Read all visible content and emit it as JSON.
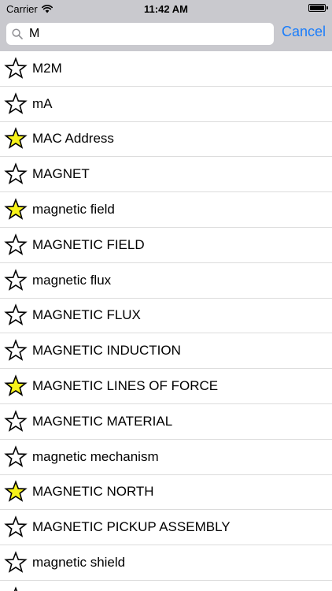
{
  "status_bar": {
    "carrier": "Carrier",
    "time": "11:42 AM"
  },
  "search": {
    "value": "M",
    "cancel_label": "Cancel"
  },
  "colors": {
    "accent": "#1a7dfb",
    "star_favorite": "#f7f21a",
    "star_outline": "#000000"
  },
  "terms": [
    {
      "label": "M2M",
      "favorite": false
    },
    {
      "label": "mA",
      "favorite": false
    },
    {
      "label": "MAC Address",
      "favorite": true
    },
    {
      "label": "MAGNET",
      "favorite": false
    },
    {
      "label": "magnetic field",
      "favorite": true
    },
    {
      "label": "MAGNETIC FIELD",
      "favorite": false
    },
    {
      "label": "magnetic flux",
      "favorite": false
    },
    {
      "label": "MAGNETIC FLUX",
      "favorite": false
    },
    {
      "label": "MAGNETIC INDUCTION",
      "favorite": false
    },
    {
      "label": "MAGNETIC LINES OF FORCE",
      "favorite": true
    },
    {
      "label": "MAGNETIC MATERIAL",
      "favorite": false
    },
    {
      "label": "magnetic mechanism",
      "favorite": false
    },
    {
      "label": "MAGNETIC NORTH",
      "favorite": true
    },
    {
      "label": "MAGNETIC PICKUP ASSEMBLY",
      "favorite": false
    },
    {
      "label": "magnetic shield",
      "favorite": false
    },
    {
      "label": "",
      "favorite": false
    }
  ]
}
